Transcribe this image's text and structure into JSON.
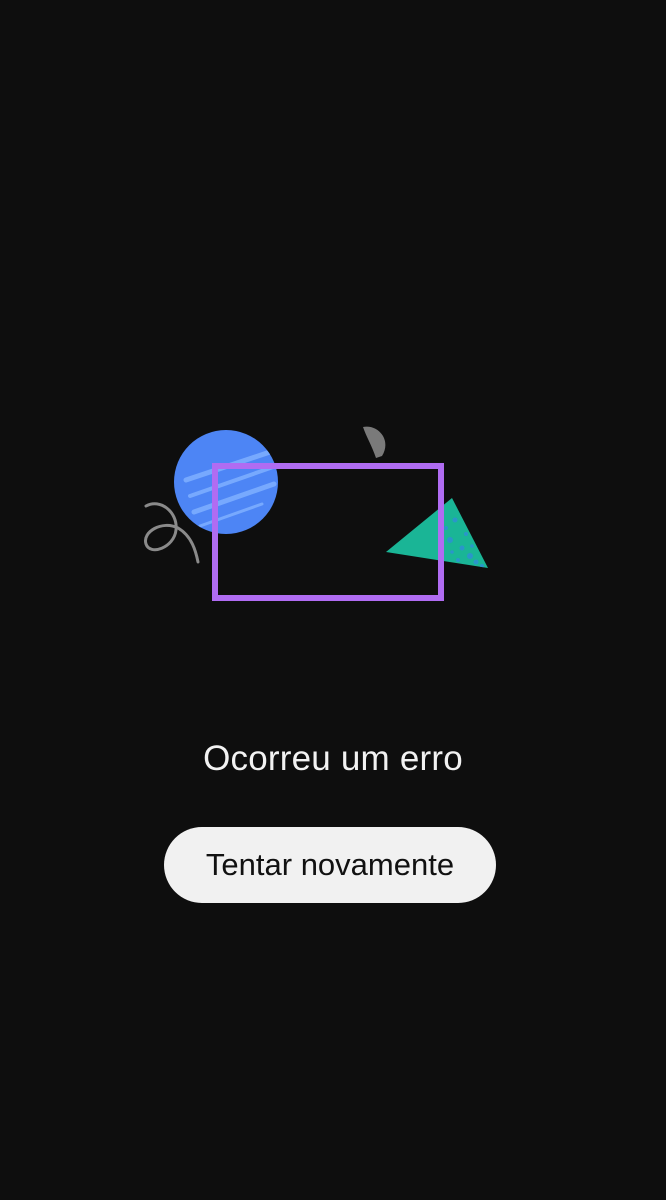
{
  "error": {
    "message": "Ocorreu um erro",
    "retry_label": "Tentar novamente"
  },
  "illustration": {
    "icon": "error-illustration",
    "colors": {
      "circle": "#4d85f5",
      "circle_stripes": "#7fb0ff",
      "frame": "#b06cf2",
      "triangle": "#1ab596",
      "triangle_speckle": "#2f8fd8",
      "squiggle": "#8a8a8a",
      "drop": "#7a7a7a"
    }
  },
  "theme": {
    "background": "#0e0e0e",
    "button_background": "#f1f1f1",
    "text": "#f2f2f2"
  }
}
